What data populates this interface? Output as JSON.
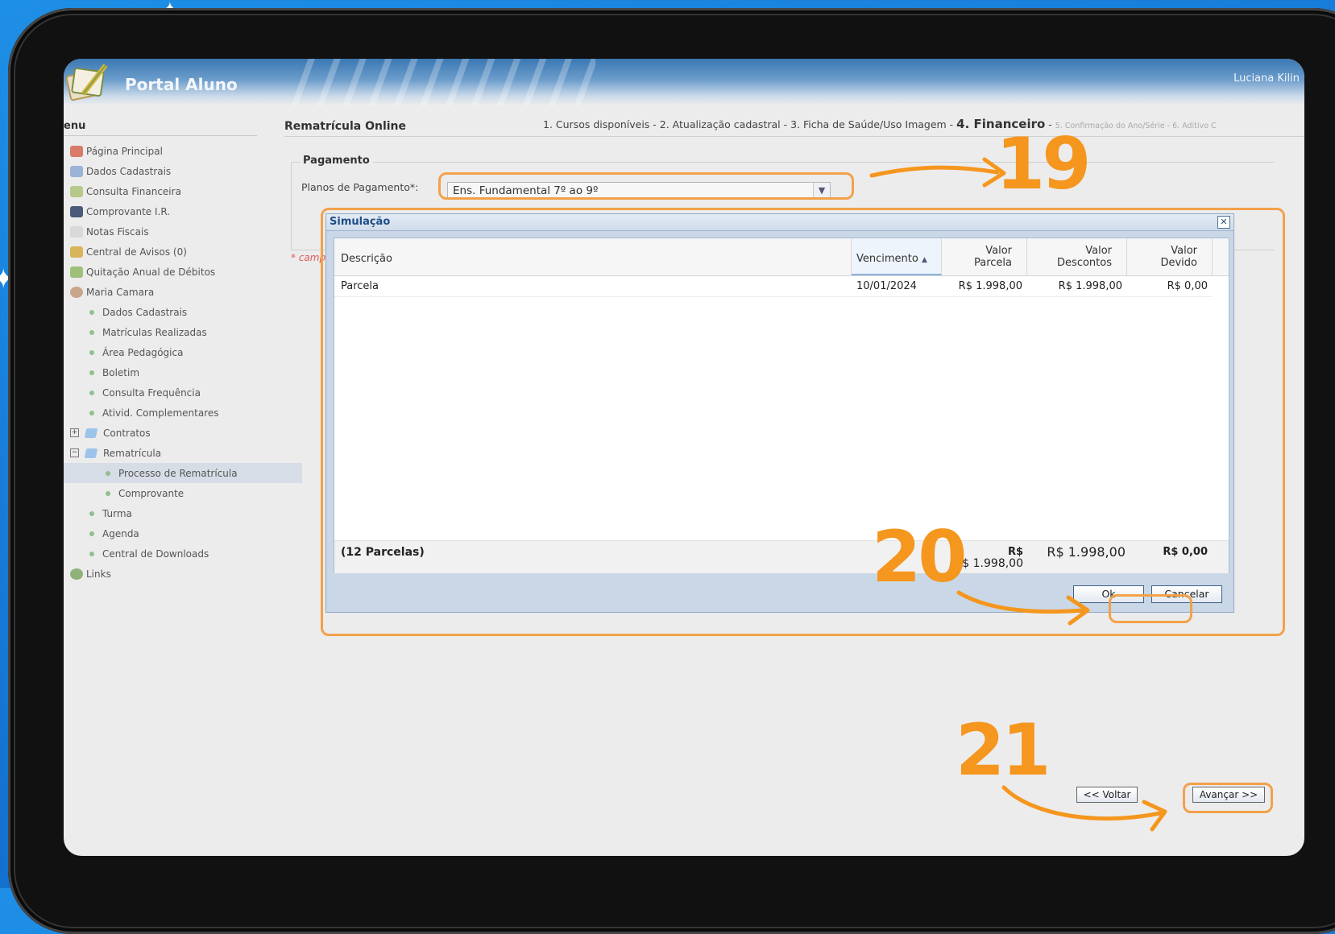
{
  "app": {
    "title": "Portal Aluno",
    "user": "Luciana Kilin"
  },
  "sidebar": {
    "title": "enu",
    "items": [
      {
        "label": "Página Principal"
      },
      {
        "label": "Dados Cadastrais"
      },
      {
        "label": "Consulta Financeira"
      },
      {
        "label": "Comprovante I.R."
      },
      {
        "label": "Notas Fiscais"
      },
      {
        "label": "Central de Avisos (0)"
      },
      {
        "label": "Quitação Anual de Débitos"
      },
      {
        "label": "Maria Camara"
      }
    ],
    "student_items": [
      {
        "label": "Dados Cadastrais"
      },
      {
        "label": "Matrículas Realizadas"
      },
      {
        "label": "Área Pedagógica"
      },
      {
        "label": "Boletim"
      },
      {
        "label": "Consulta Frequência"
      },
      {
        "label": "Ativid. Complementares"
      }
    ],
    "contratos": "Contratos",
    "rematricula": "Rematrícula",
    "rematricula_items": [
      {
        "label": "Processo de Rematrícula"
      },
      {
        "label": "Comprovante"
      }
    ],
    "bottom_items": [
      {
        "label": "Turma"
      },
      {
        "label": "Agenda"
      },
      {
        "label": "Central de Downloads"
      }
    ],
    "links": "Links"
  },
  "main": {
    "heading": "Rematrícula Online",
    "steps_prefix": "1. Cursos disponíveis - 2. Atualização cadastral - 3. Ficha de Saúde/Uso Imagem - ",
    "step_current": "4. Financeiro",
    "steps_sep": " - ",
    "steps_next": "5. Confirmação do Ano/Série - 6. Aditivo C",
    "payment_legend": "Pagamento",
    "plan_label": "Planos de Pagamento*:",
    "plan_value": "Ens. Fundamental 7º ao 9º",
    "required_note": "* campo"
  },
  "modal": {
    "title": "Simulação",
    "columns": {
      "descricao": "Descrição",
      "vencimento": "Vencimento",
      "valor_parcela_1": "Valor",
      "valor_parcela_2": "Parcela",
      "valor_descontos_1": "Valor",
      "valor_descontos_2": "Descontos",
      "valor_devido_1": "Valor",
      "valor_devido_2": "Devido"
    },
    "rows": [
      {
        "descricao": "Parcela",
        "vencimento": "10/01/2024",
        "valor_parcela": "R$ 1.998,00",
        "valor_descontos": "R$ 1.998,00",
        "valor_devido": "R$ 0,00"
      }
    ],
    "footer": {
      "count": "(12 Parcelas)",
      "parcela_1": "R$",
      "parcela_2": "R$ 1.998,00",
      "descontos": "R$ 1.998,00",
      "devido": "R$ 0,00"
    },
    "ok_label": "Ok",
    "cancel_label": "Cancelar"
  },
  "nav": {
    "back_label": "<< Voltar",
    "next_label": "Avançar >>"
  },
  "annotations": {
    "step19": "19",
    "step20": "20",
    "step21": "21",
    "color": "#f5961e"
  }
}
